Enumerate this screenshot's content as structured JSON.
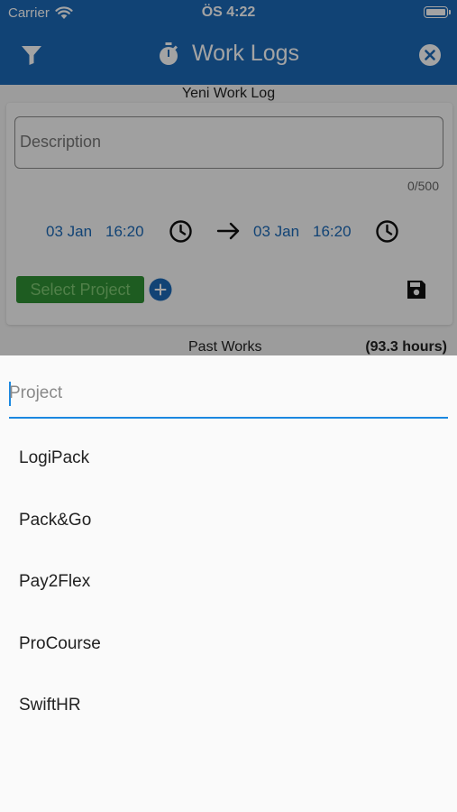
{
  "status_bar": {
    "carrier": "Carrier",
    "time": "ÖS 4:22"
  },
  "toolbar": {
    "title": "Work Logs",
    "left_icon": "filter-icon",
    "title_icon": "stopwatch-icon",
    "right_icon": "close-circle-icon"
  },
  "form": {
    "section_title": "Yeni Work Log",
    "description_placeholder": "Description",
    "char_counter": "0/500",
    "start": {
      "date": "03 Jan",
      "time": "16:20"
    },
    "end": {
      "date": "03 Jan",
      "time": "16:20"
    },
    "select_project_label": "Select Project"
  },
  "past": {
    "label": "Past Works",
    "hours": "(93.3 hours)"
  },
  "sheet": {
    "search_placeholder": "Project",
    "projects": [
      "LogiPack",
      "Pack&Go",
      "Pay2Flex",
      "ProCourse",
      "SwiftHR"
    ]
  },
  "colors": {
    "primary": "#1b69b8",
    "accent": "#1b88e0",
    "project_button": "#2f9135"
  }
}
